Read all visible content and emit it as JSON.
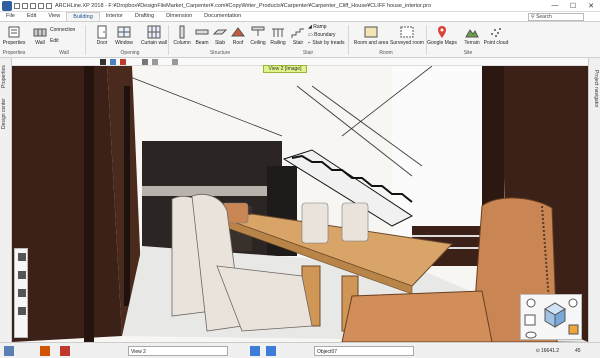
{
  "titlebar": {
    "title": "ARCHLine.XP 2018 - F:¥Dropbox¥DesignFileMarket_Carpenter¥.com¥CopyWriter_Products¥Carpenter¥Carpenter_Cliff_House¥CLIFF house_interior.pro",
    "minimize": "—",
    "maximize": "☐",
    "close": "✕"
  },
  "tabs": [
    "File",
    "Edit",
    "View",
    "Building",
    "Interior",
    "Drafting",
    "Dimension",
    "Documentation"
  ],
  "active_tab": "Building",
  "search": {
    "label": "Search"
  },
  "ribbon": {
    "buttons": {
      "properties": "Properties",
      "wall": "Wall",
      "door": "Door",
      "window": "Window",
      "curtain_wall": "Curtain wall",
      "column": "Column",
      "beam": "Beam",
      "slab": "Slab",
      "roof": "Roof",
      "ceiling": "Ceiling",
      "railing": "Railing",
      "stair": "Stair",
      "room_and_area": "Room and area",
      "surveyed_room": "Surveyed room",
      "google_maps": "Google Maps",
      "terrain": "Terrain",
      "point_cloud": "Point cloud"
    },
    "small": {
      "connection": "Connection",
      "edit": "Edit",
      "ramp": "Ramp",
      "boundary": "Boundary",
      "stair_by_treads": "Stair by treads"
    },
    "groups": {
      "properties": "Properties",
      "wall": "Wall",
      "opening": "Opening",
      "structure": "Structure",
      "stair": "Stair",
      "room": "Room",
      "site": "Site"
    }
  },
  "left_panel": {
    "properties": "Properties",
    "design_center": "Design center"
  },
  "right_panel": {
    "project_navigator": "Project navigator"
  },
  "view_label": "View 2 [Image]",
  "statusbar": {
    "view": "View 2",
    "object": "Object07",
    "coordinates": "16641.2",
    "extra": "45"
  },
  "colors": {
    "accent": "#1a4f8b",
    "view_label_bg": "#dff58a",
    "wood_dark": "#3b2117",
    "wood_light": "#d9a467",
    "chair_fabric": "#e9e3dc",
    "armchair": "#c98654"
  }
}
